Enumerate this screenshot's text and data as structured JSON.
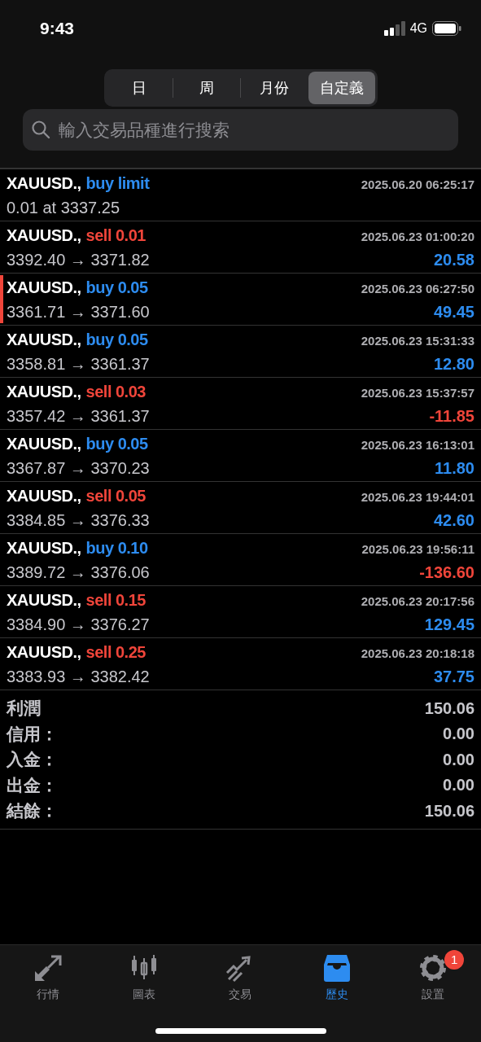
{
  "status_bar": {
    "time": "9:43",
    "network": "4G"
  },
  "period_tabs": [
    {
      "label": "日",
      "selected": false
    },
    {
      "label": "周",
      "selected": false
    },
    {
      "label": "月份",
      "selected": false
    },
    {
      "label": "自定義",
      "selected": true
    }
  ],
  "search": {
    "placeholder": "輸入交易品種進行搜索"
  },
  "orders": [
    {
      "symbol": "XAUUSD.,",
      "sell": false,
      "action": "buy limit",
      "prices": "0.01 at 3337.25",
      "time": "2025.06.20 06:25:17",
      "marked": false
    },
    {
      "symbol": "XAUUSD.,",
      "sell": true,
      "action": "sell 0.01",
      "prices": "3392.40 → 3371.82",
      "time": "2025.06.23 01:00:20",
      "profit": "20.58",
      "loss": false,
      "marked": false
    },
    {
      "symbol": "XAUUSD.,",
      "sell": false,
      "action": "buy 0.05",
      "prices": "3361.71 → 3371.60",
      "time": "2025.06.23 06:27:50",
      "profit": "49.45",
      "loss": false,
      "marked": true
    },
    {
      "symbol": "XAUUSD.,",
      "sell": false,
      "action": "buy 0.05",
      "prices": "3358.81 → 3361.37",
      "time": "2025.06.23 15:31:33",
      "profit": "12.80",
      "loss": false,
      "marked": false
    },
    {
      "symbol": "XAUUSD.,",
      "sell": true,
      "action": "sell 0.03",
      "prices": "3357.42 → 3361.37",
      "time": "2025.06.23 15:37:57",
      "profit": "-11.85",
      "loss": true,
      "marked": false
    },
    {
      "symbol": "XAUUSD.,",
      "sell": false,
      "action": "buy 0.05",
      "prices": "3367.87 → 3370.23",
      "time": "2025.06.23 16:13:01",
      "profit": "11.80",
      "loss": false,
      "marked": false
    },
    {
      "symbol": "XAUUSD.,",
      "sell": true,
      "action": "sell 0.05",
      "prices": "3384.85 → 3376.33",
      "time": "2025.06.23 19:44:01",
      "profit": "42.60",
      "loss": false,
      "marked": false
    },
    {
      "symbol": "XAUUSD.,",
      "sell": false,
      "action": "buy 0.10",
      "prices": "3389.72 → 3376.06",
      "time": "2025.06.23 19:56:11",
      "profit": "-136.60",
      "loss": true,
      "marked": false
    },
    {
      "symbol": "XAUUSD.,",
      "sell": true,
      "action": "sell 0.15",
      "prices": "3384.90 → 3376.27",
      "time": "2025.06.23 20:17:56",
      "profit": "129.45",
      "loss": false,
      "marked": false
    },
    {
      "symbol": "XAUUSD.,",
      "sell": true,
      "action": "sell 0.25",
      "prices": "3383.93 → 3382.42",
      "time": "2025.06.23 20:18:18",
      "profit": "37.75",
      "loss": false,
      "marked": false
    }
  ],
  "summary": [
    {
      "label": "利潤",
      "value": "150.06"
    },
    {
      "label": "信用：",
      "value": "0.00"
    },
    {
      "label": "入金：",
      "value": "0.00"
    },
    {
      "label": "出金：",
      "value": "0.00"
    },
    {
      "label": "結餘：",
      "value": "150.06"
    }
  ],
  "tab_bar": [
    {
      "kind": "quotes",
      "label": "行情",
      "selected": false
    },
    {
      "kind": "chart",
      "label": "圖表",
      "selected": false
    },
    {
      "kind": "trade",
      "label": "交易",
      "selected": false
    },
    {
      "kind": "history",
      "label": "歷史",
      "selected": true
    },
    {
      "kind": "settings",
      "label": "設置",
      "selected": false,
      "badge": "1"
    }
  ]
}
